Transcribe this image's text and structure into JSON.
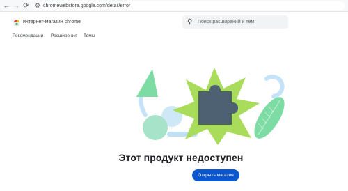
{
  "browser": {
    "back_glyph": "←",
    "forward_glyph": "→",
    "reload_glyph": "⟳",
    "site_info_glyph": "⚙",
    "url": "chromewebstore.google.com/detail/error"
  },
  "header": {
    "store_name": "интернет-магазин chrome",
    "search_glyph": "⚲",
    "search_placeholder": "Поиск расширений и тем"
  },
  "tabs": [
    {
      "label": "Рекомендации"
    },
    {
      "label": "Расширения"
    },
    {
      "label": "Темы"
    }
  ],
  "main": {
    "error_title": "Этот продукт недоступен",
    "open_store_label": "Открыть магазин"
  },
  "colors": {
    "accent": "#0b57d0",
    "star_green": "#a8dc5a",
    "puzzle": "#4e6172",
    "mint": "#7ddba4",
    "light_blue": "#c4e2f8"
  },
  "icons": {
    "logo": "chrome-web-store-logo",
    "illustration": "unavailable-extension-illustration"
  }
}
